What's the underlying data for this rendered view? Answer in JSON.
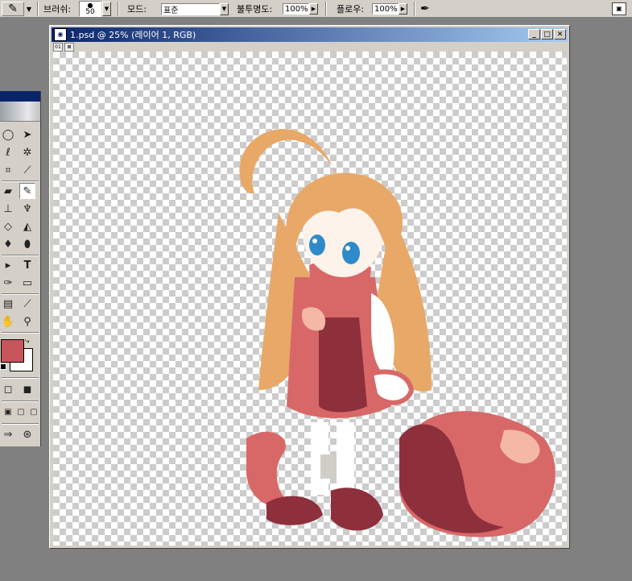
{
  "options_bar": {
    "brush_label": "브러쉬:",
    "brush_size": "50",
    "mode_label": "모드:",
    "mode_value": "표준",
    "opacity_label": "불투명도:",
    "opacity_value": "100%",
    "flow_label": "플로우:",
    "flow_value": "100%"
  },
  "document": {
    "title": "1.psd @ 25% (레이어 1, RGB)",
    "status_icon_1": "01",
    "status_icon_2": "⊠"
  },
  "colors": {
    "foreground": "#c8545c",
    "background": "#ffffff",
    "hair": "#e8a868",
    "dress": "#d86868",
    "dark_red": "#8e2f3c",
    "light_pink": "#f4b8a4",
    "eyes": "#2f8ac8"
  },
  "tools": [
    "marquee-tool",
    "move-tool",
    "lasso-tool",
    "magic-wand-tool",
    "crop-tool",
    "slice-tool",
    "healing-tool",
    "brush-tool",
    "clone-stamp-tool",
    "history-brush-tool",
    "eraser-tool",
    "paint-bucket-tool",
    "blur-tool",
    "dodge-tool",
    "path-selection-tool",
    "type-tool",
    "pen-tool",
    "shape-tool",
    "notes-tool",
    "eyedropper-tool",
    "hand-tool",
    "zoom-tool"
  ]
}
